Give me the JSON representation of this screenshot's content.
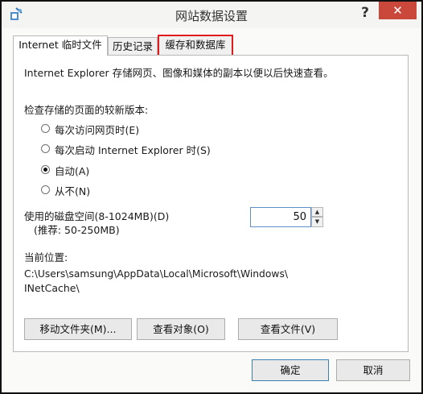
{
  "window": {
    "title": "网站数据设置",
    "help_label": "?",
    "close_label": "✕"
  },
  "tabs": [
    {
      "label": "Internet 临时文件"
    },
    {
      "label": "历史记录"
    },
    {
      "label": "缓存和数据库"
    }
  ],
  "panel": {
    "description": "Internet Explorer 存储网页、图像和媒体的副本以便以后快速查看。",
    "check_label": "检查存储的页面的较新版本:",
    "options": [
      {
        "label": "每次访问网页时(E)",
        "selected": false
      },
      {
        "label": "每次启动 Internet Explorer 时(S)",
        "selected": false
      },
      {
        "label": "自动(A)",
        "selected": true
      },
      {
        "label": "从不(N)",
        "selected": false
      }
    ],
    "disk_label": "使用的磁盘空间(8-1024MB)(D)",
    "disk_hint": "(推荐: 50-250MB)",
    "disk_value": "50",
    "location_label": "当前位置:",
    "location_line1": "C:\\Users\\samsung\\AppData\\Local\\Microsoft\\Windows\\",
    "location_line2": "INetCache\\",
    "buttons": {
      "move": "移动文件夹(M)...",
      "view_objects": "查看对象(O)",
      "view_files": "查看文件(V)"
    }
  },
  "footer": {
    "ok": "确定",
    "cancel": "取消"
  }
}
